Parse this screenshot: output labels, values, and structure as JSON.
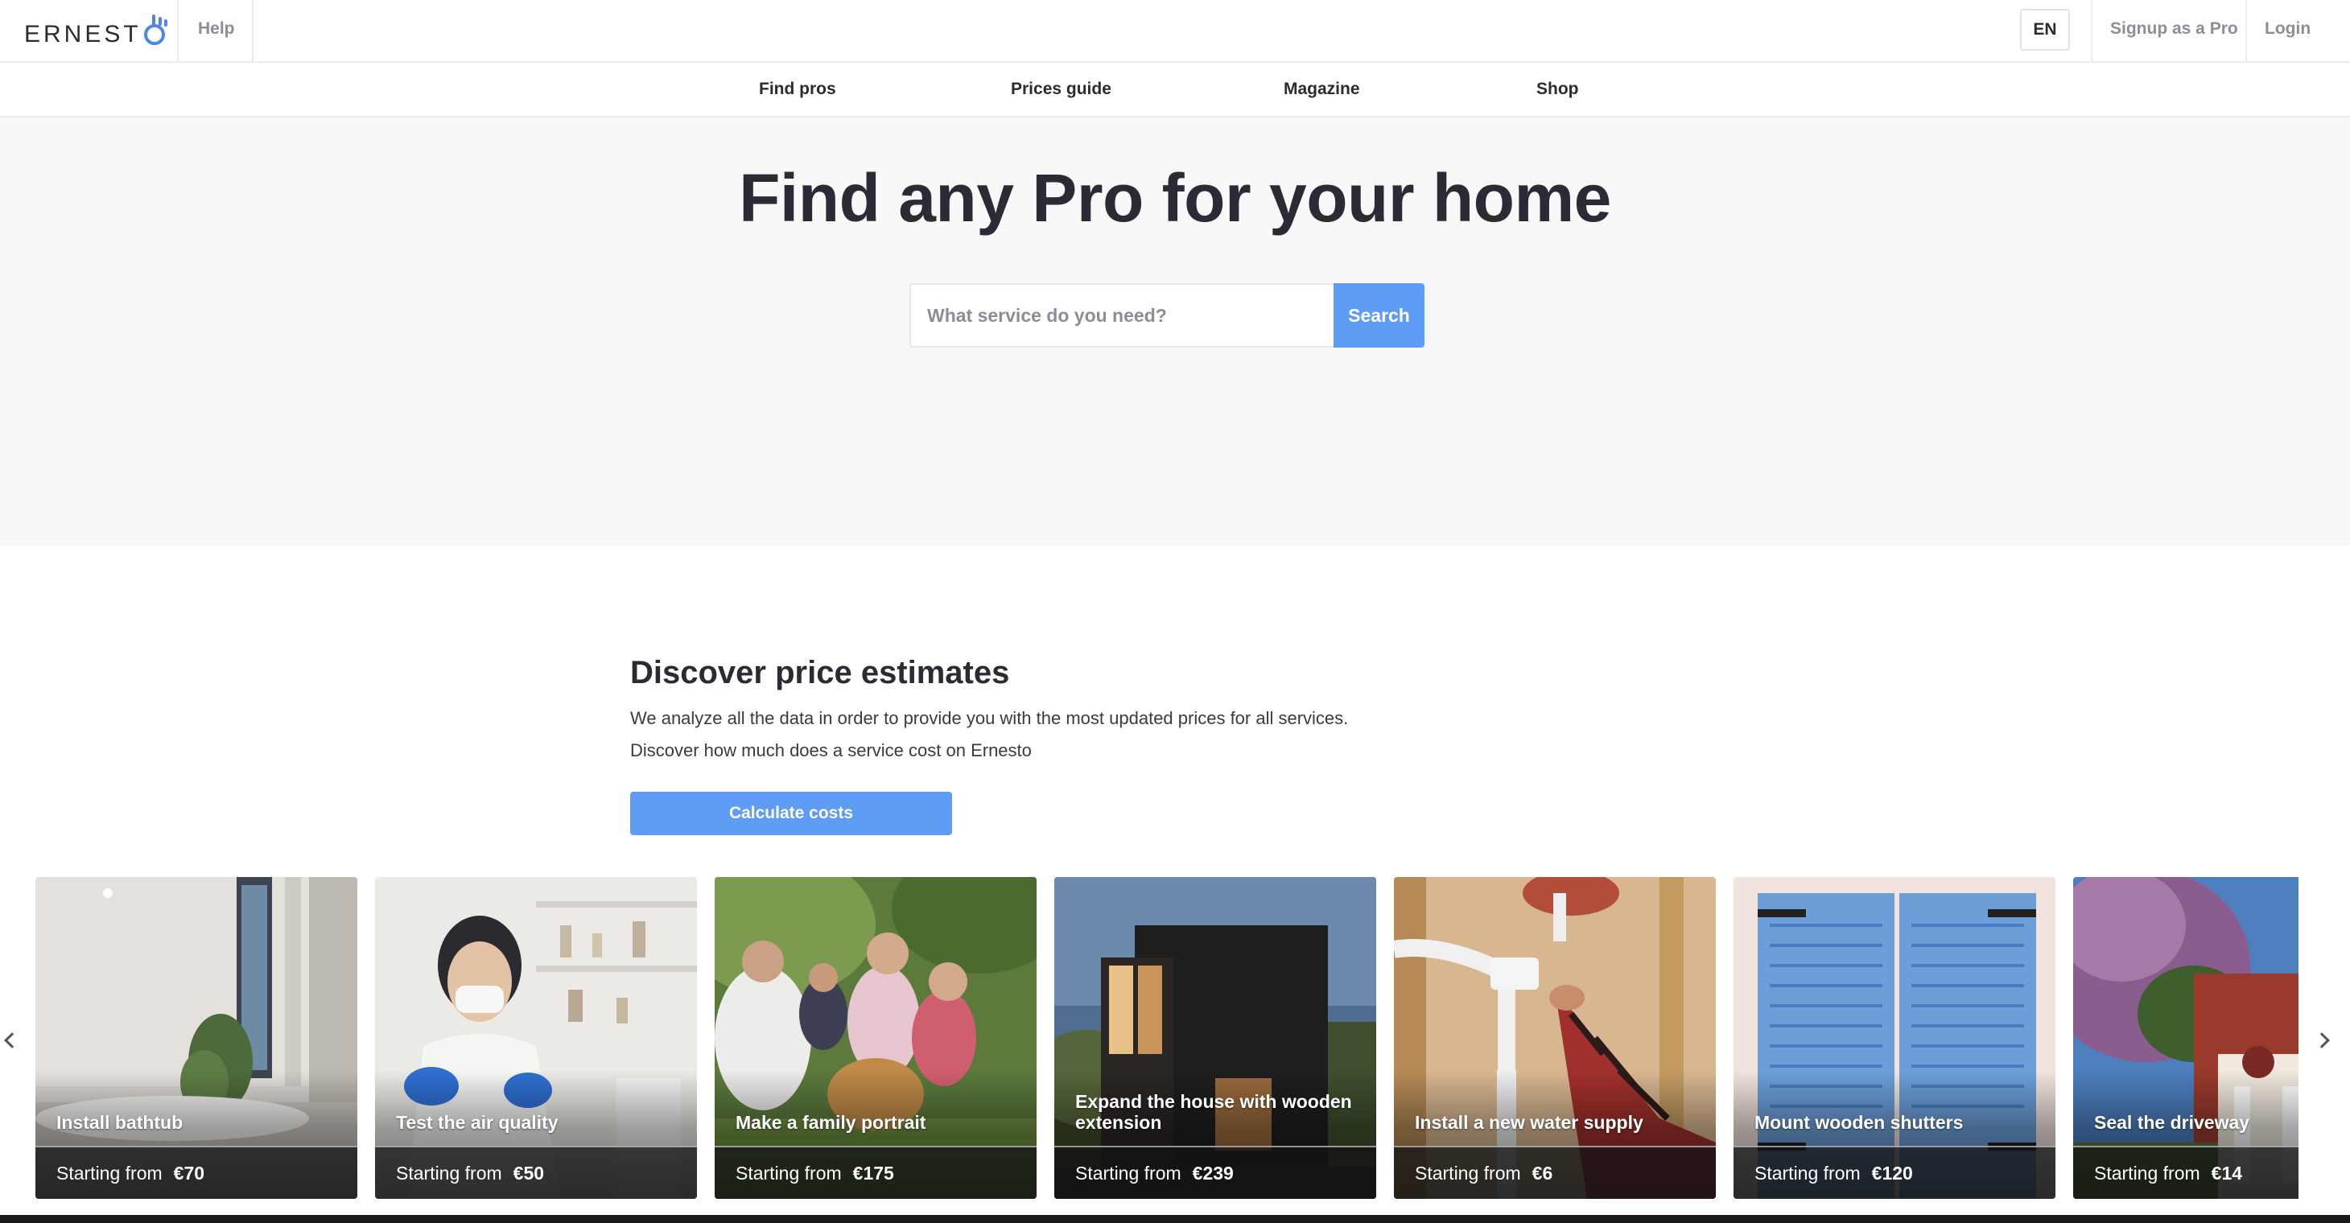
{
  "header": {
    "logo_text": "ERNESTO",
    "help_label": "Help",
    "language_label": "EN",
    "signup_label": "Signup as a Pro",
    "login_label": "Login"
  },
  "nav": {
    "items": [
      {
        "label": "Find pros"
      },
      {
        "label": "Prices guide"
      },
      {
        "label": "Magazine"
      },
      {
        "label": "Shop"
      }
    ]
  },
  "hero": {
    "title": "Find any Pro for your home",
    "search_placeholder": "What service do you need?",
    "search_value": "",
    "search_button_label": "Search"
  },
  "estimates": {
    "title": "Discover price estimates",
    "description_line1": "We analyze all the data in order to provide you with the most updated prices for all services.",
    "description_line2": "Discover how much does a service cost on Ernesto",
    "button_label": "Calculate costs"
  },
  "carousel": {
    "prev_icon": "chevron-left-icon",
    "next_icon": "chevron-right-icon",
    "cards": [
      {
        "name": "Install bathtub",
        "price_prefix": "Starting from",
        "price": "€70"
      },
      {
        "name": "Test the air quality",
        "price_prefix": "Starting from",
        "price": "€50"
      },
      {
        "name": "Make a family portrait",
        "price_prefix": "Starting from",
        "price": "€175"
      },
      {
        "name": "Expand the house with wooden extension",
        "price_prefix": "Starting from",
        "price": "€239"
      },
      {
        "name": "Install a new water supply",
        "price_prefix": "Starting from",
        "price": "€6"
      },
      {
        "name": "Mount wooden shutters",
        "price_prefix": "Starting from",
        "price": "€120"
      },
      {
        "name": "Seal the driveway",
        "price_prefix": "Starting from",
        "price": "€14"
      }
    ]
  },
  "colors": {
    "accent": "#5f9cf5",
    "logo_blue": "#4f86e8",
    "text_dark": "#2b2b35",
    "text_muted": "#8d8d99",
    "hero_bg": "#f8f8f8"
  }
}
